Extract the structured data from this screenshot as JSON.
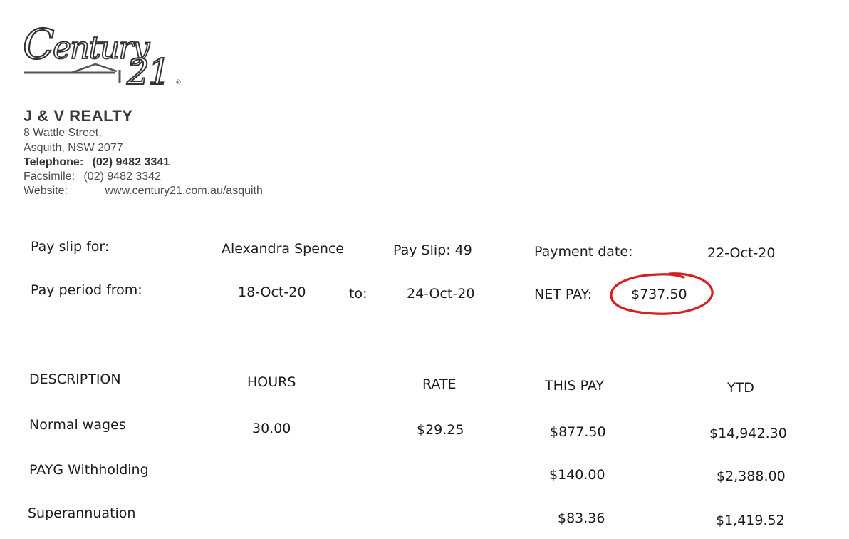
{
  "logo": {
    "wordmark": "Century",
    "number": "21",
    "trademark": "®"
  },
  "company": {
    "name": "J & V REALTY",
    "address_line1": "8 Wattle Street,",
    "address_line2": "Asquith, NSW 2077",
    "telephone_label": "Telephone:",
    "telephone": "(02) 9482 3341",
    "facsimile_label": "Facsimile:",
    "facsimile": "(02) 9482 3342",
    "website_label": "Website:",
    "website": "www.century21.com.au/asquith"
  },
  "payslip": {
    "for_label": "Pay slip for:",
    "employee": "Alexandra Spence",
    "slip_number": "Pay Slip: 49",
    "payment_date_label": "Payment date:",
    "payment_date": "22-Oct-20",
    "period_label": "Pay period from:",
    "period_from": "18-Oct-20",
    "to_label": "to:",
    "period_to": "24-Oct-20",
    "net_pay_label": "NET PAY:",
    "net_pay": "$737.50",
    "annotation_color": "#d42020"
  },
  "table": {
    "headers": {
      "description": "DESCRIPTION",
      "hours": "HOURS",
      "rate": "RATE",
      "this_pay": "THIS PAY",
      "ytd": "YTD"
    },
    "rows": [
      {
        "description": "Normal wages",
        "hours": "30.00",
        "rate": "$29.25",
        "this_pay": "$877.50",
        "ytd": "$14,942.30"
      },
      {
        "description": "PAYG Withholding",
        "hours": "",
        "rate": "",
        "this_pay": "$140.00",
        "ytd": "$2,388.00"
      },
      {
        "description": "Superannuation",
        "hours": "",
        "rate": "",
        "this_pay": "$83.36",
        "ytd": "$1,419.52"
      }
    ]
  }
}
